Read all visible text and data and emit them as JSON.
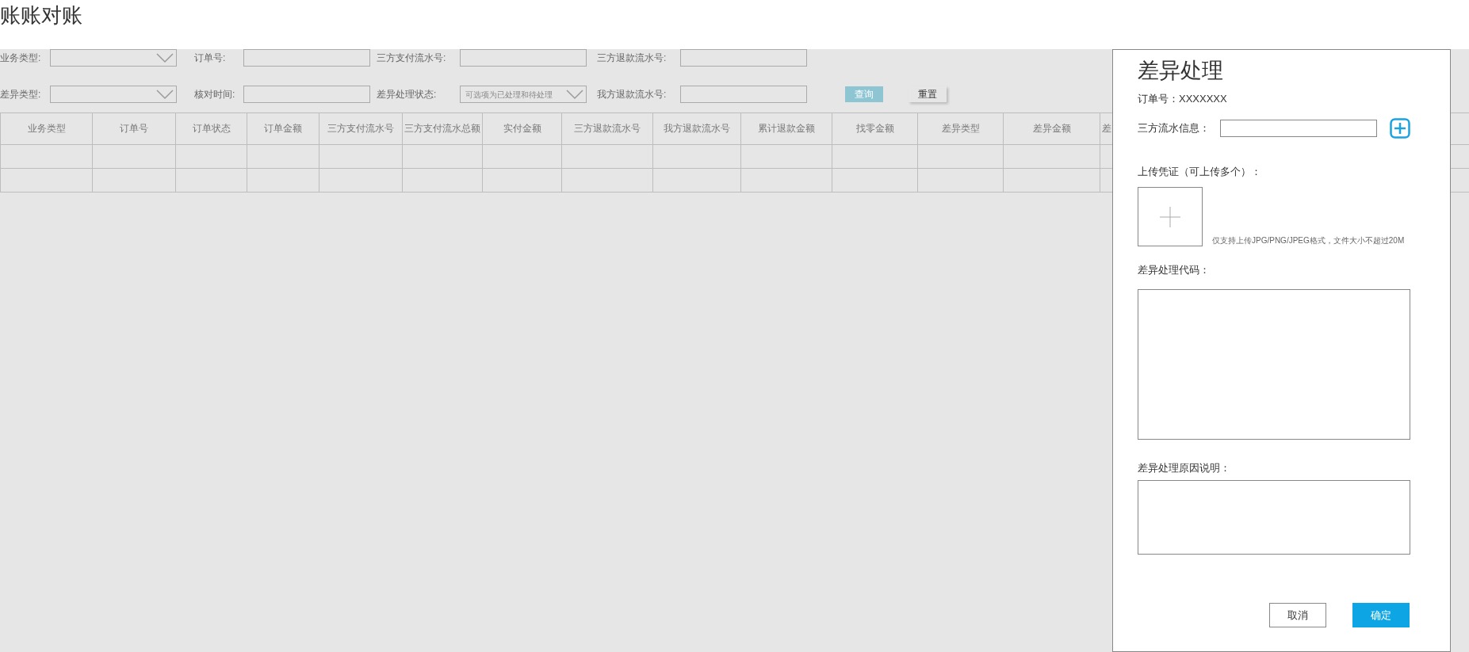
{
  "page_title": "账账对账",
  "filters": [
    [
      {
        "label": "业务类型:",
        "kind": "select"
      },
      {
        "label": "订单号:",
        "kind": "input"
      },
      {
        "label": "三方支付流水号:",
        "kind": "input"
      },
      {
        "label": "三方退款流水号:",
        "kind": "input"
      }
    ],
    [
      {
        "label": "差异类型:",
        "kind": "select"
      },
      {
        "label": "核对时间:",
        "kind": "input"
      },
      {
        "label": "差异处理状态:",
        "kind": "select",
        "placeholder": "可选项为已处理和待处理"
      },
      {
        "label": "我方退款流水号:",
        "kind": "input"
      }
    ]
  ],
  "filter_buttons": [
    {
      "label": "查询",
      "kind": "primary"
    },
    {
      "label": "重置",
      "kind": "plain"
    }
  ],
  "table": {
    "columns": [
      "业务类型",
      "订单号",
      "订单状态",
      "订单金额",
      "三方支付流水号",
      "三方支付流水总额",
      "实付金额",
      "三方退款流水号",
      "我方退款流水号",
      "累计退款金额",
      "找零金额",
      "差异类型",
      "差异金额",
      "差"
    ],
    "row_count_rows": [
      {},
      {}
    ]
  },
  "dialog": {
    "title": "差异处理",
    "order_line": "订单号：XXXXXXX",
    "flow_label": "三方流水信息：",
    "upload_label": "上传凭证（可上传多个）：",
    "upload_hint": "仅支持上传JPG/PNG/JPEG格式，文件大小不超过20M",
    "code_label": "差异处理代码：",
    "reason_label": "差异处理原因说明：",
    "buttons": [
      {
        "label": "取消",
        "kind": "plain"
      },
      {
        "label": "确定",
        "kind": "primary"
      }
    ]
  }
}
